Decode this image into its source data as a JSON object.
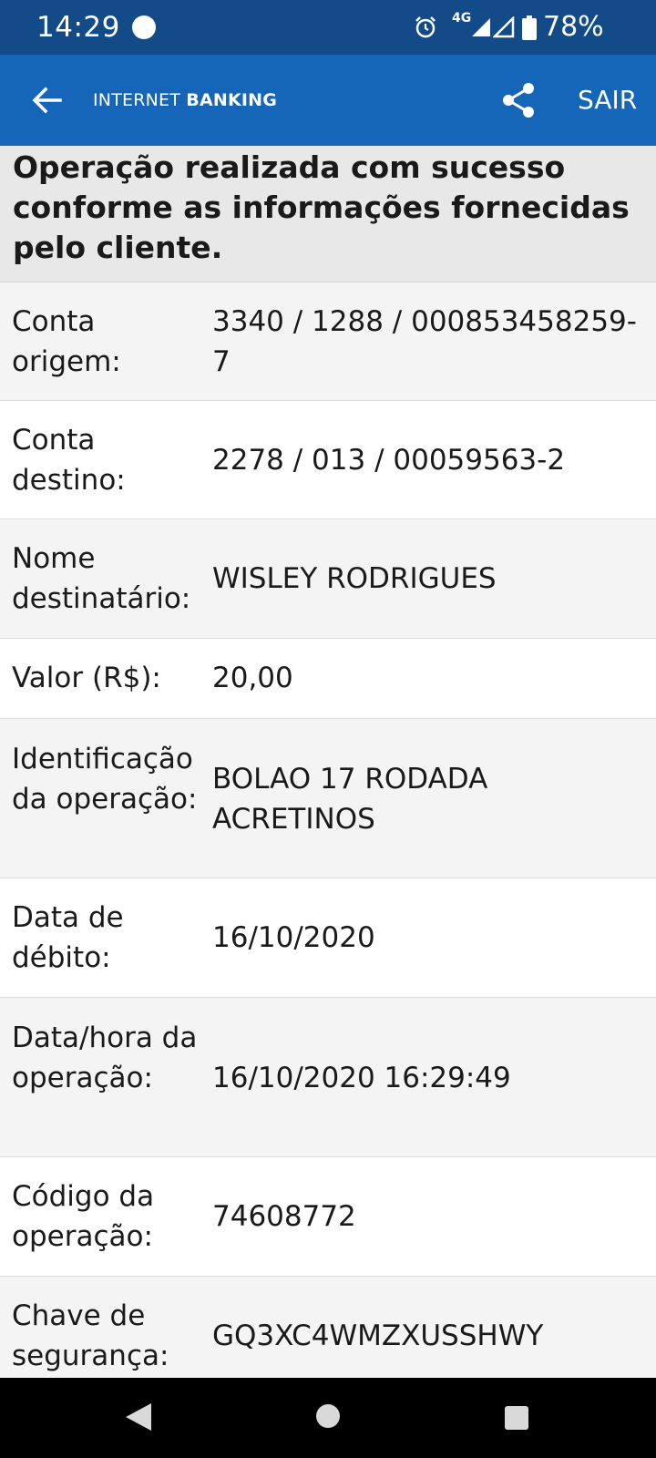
{
  "status_bar": {
    "time": "14:29",
    "network": "4G",
    "battery": "78%"
  },
  "app_bar": {
    "title_regular": "INTERNET ",
    "title_bold": "BANKING",
    "logout_label": "SAIR"
  },
  "banner": {
    "message": "Operação realizada com sucesso conforme as informações fornecidas pelo cliente."
  },
  "details": [
    {
      "label": "Conta origem:",
      "value": "3340 / 1288 / 000853458259-7"
    },
    {
      "label": "Conta destino:",
      "value": "2278 / 013 / 00059563-2"
    },
    {
      "label": "Nome destinatário:",
      "value": "WISLEY RODRIGUES"
    },
    {
      "label": "Valor (R$):",
      "value": "20,00"
    },
    {
      "label": "Identificação da operação:",
      "value": "BOLAO 17 RODADA ACRETINOS"
    },
    {
      "label": "Data de débito:",
      "value": "16/10/2020"
    },
    {
      "label": "Data/hora da operação:",
      "value": "16/10/2020 16:29:49"
    },
    {
      "label": "Código da operação:",
      "value": "74608772"
    },
    {
      "label": "Chave de segurança:",
      "value": "GQ3XC4WMZXUSSHWY"
    }
  ],
  "colors": {
    "status_bar": "#134b89",
    "app_bar": "#1565b8",
    "banner_bg": "#e8e8e8",
    "row_shade": "#f5f4f4"
  }
}
